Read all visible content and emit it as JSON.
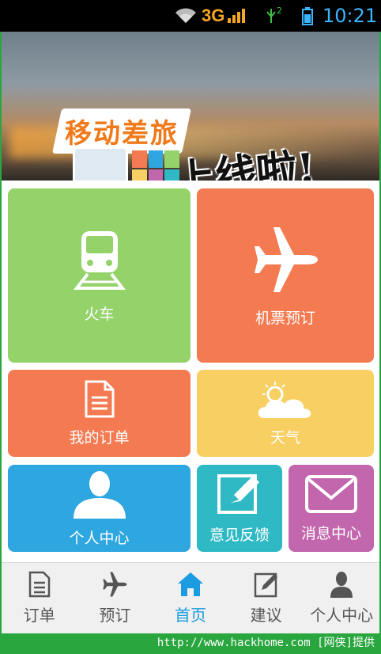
{
  "status_bar": {
    "network": "3G",
    "sim_badge": "2",
    "time": "10:21",
    "accent_color": "#3cb5ff"
  },
  "banner": {
    "title": "移动差旅",
    "subtitle": "上线啦!"
  },
  "tiles": {
    "train": {
      "label": "火车",
      "icon": "train-icon",
      "color": "#94d26a"
    },
    "flight": {
      "label": "机票预订",
      "icon": "airplane-icon",
      "color": "#f47a52"
    },
    "orders": {
      "label": "我的订单",
      "icon": "document-icon",
      "color": "#f47a52"
    },
    "weather": {
      "label": "天气",
      "icon": "weather-icon",
      "color": "#f7cf62"
    },
    "user_center": {
      "label": "个人中心",
      "icon": "person-icon",
      "color": "#2ea6e0"
    },
    "feedback": {
      "label": "意见反馈",
      "icon": "pencil-icon",
      "color": "#2fb9c4"
    },
    "messages": {
      "label": "消息中心",
      "icon": "envelope-icon",
      "color": "#c266ad"
    }
  },
  "tabbar": {
    "items": [
      {
        "label": "订单",
        "icon": "document-icon",
        "active": false
      },
      {
        "label": "预订",
        "icon": "airplane-icon",
        "active": false
      },
      {
        "label": "首页",
        "icon": "home-icon",
        "active": true
      },
      {
        "label": "建议",
        "icon": "edit-icon",
        "active": false
      },
      {
        "label": "个人中心",
        "icon": "person-icon",
        "active": false
      }
    ],
    "active_color": "#1b9be0"
  },
  "footer": {
    "text": "http://www.hackhome.com [网侠]提供"
  }
}
